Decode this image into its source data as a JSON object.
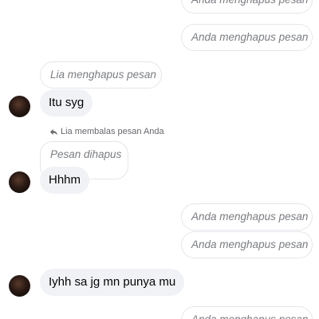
{
  "messages": {
    "sent_deleted_1": "Anda menghapus pesan",
    "sent_deleted_2": "Anda menghapus pesan",
    "lia_deleted": "Lia menghapus pesan",
    "msg_1": "Itu syg",
    "reply_indicator": "Lia membalas pesan Anda",
    "replied_deleted": "Pesan dihapus",
    "msg_2": "Hhhm",
    "sent_deleted_3": "Anda menghapus pesan",
    "sent_deleted_4": "Anda menghapus pesan",
    "msg_3": "Iyhh sa jg mn punya mu",
    "sent_deleted_5": "Anda menghapus pesan"
  },
  "colors": {
    "incoming_bubble": "#f0f2f5",
    "deleted_border": "#e4e6eb",
    "deleted_text": "#7a7d82",
    "reply_text": "#65676b"
  }
}
